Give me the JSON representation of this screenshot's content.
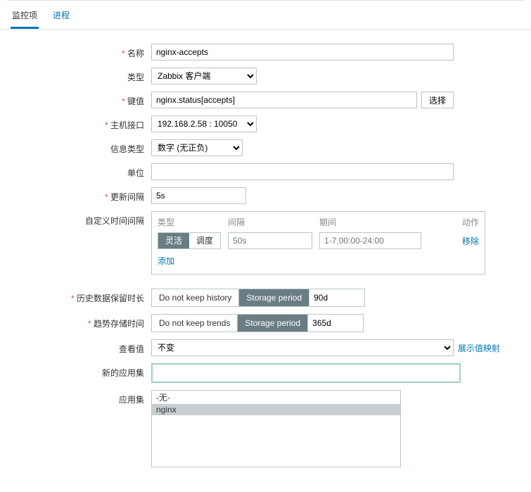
{
  "tabs": {
    "monitor": "监控项",
    "process": "进程"
  },
  "labels": {
    "name": "名称",
    "type": "类型",
    "key": "键值",
    "iface": "主机接口",
    "infoType": "信息类型",
    "unit": "单位",
    "update": "更新间隔",
    "custom": "自定义时间间隔",
    "history": "历史数据保留时长",
    "trend": "趋势存储时间",
    "show": "查看值",
    "newApp": "新的应用集",
    "app": "应用集"
  },
  "values": {
    "name": "nginx-accepts",
    "type": "Zabbix 客户端",
    "key": "nginx.status[accepts]",
    "iface": "192.168.2.58 : 10050",
    "infoType": "数字 (无正负)",
    "unit": "",
    "update": "5s"
  },
  "buttons": {
    "select": "选择"
  },
  "customBox": {
    "cols": {
      "type": "类型",
      "interval": "间隔",
      "period": "期间",
      "action": "动作"
    },
    "segActive": "灵活",
    "segOther": "调度",
    "ph1": "50s",
    "ph2": "1-7,00:00-24:00",
    "remove": "移除",
    "add": "添加"
  },
  "history": {
    "noKeep": "Do not keep history",
    "storage": "Storage period",
    "value": "90d"
  },
  "trend": {
    "noKeep": "Do not keep trends",
    "storage": "Storage period",
    "value": "365d"
  },
  "show": {
    "value": "不变",
    "mapLink": "展示值映射"
  },
  "applist": {
    "none": "-无-",
    "nginx": "nginx"
  }
}
